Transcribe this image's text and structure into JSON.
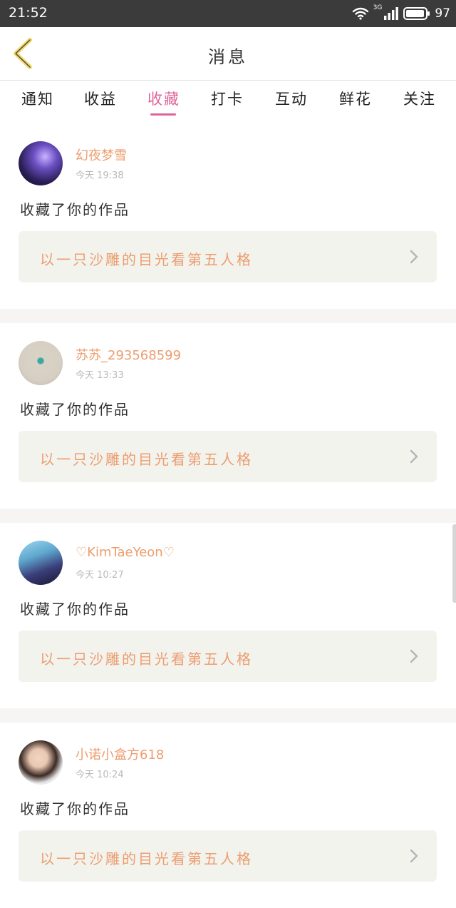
{
  "status_bar": {
    "time": "21:52",
    "network": "3G",
    "battery": "97",
    "battery_level": 0.97
  },
  "header": {
    "title": "消息"
  },
  "tabs": [
    {
      "label": "通知"
    },
    {
      "label": "收益"
    },
    {
      "label": "收藏"
    },
    {
      "label": "打卡"
    },
    {
      "label": "互动"
    },
    {
      "label": "鲜花"
    },
    {
      "label": "关注"
    }
  ],
  "active_tab": "收藏",
  "colors": {
    "accent_pink": "#e0649a",
    "accent_orange": "#ec9d6f",
    "card_bg": "#f3f3ee"
  },
  "notifications": [
    {
      "user": "幻夜梦雪",
      "time": "今天 19:38",
      "action": "收藏了你的作品",
      "work": "以一只沙雕的目光看第五人格"
    },
    {
      "user": "苏苏_293568599",
      "time": "今天 13:33",
      "action": "收藏了你的作品",
      "work": "以一只沙雕的目光看第五人格"
    },
    {
      "user": "♡KimTaeYeon♡",
      "time": "今天 10:27",
      "action": "收藏了你的作品",
      "work": "以一只沙雕的目光看第五人格"
    },
    {
      "user": "小诺小盒方618",
      "time": "今天 10:24",
      "action": "收藏了你的作品",
      "work": "以一只沙雕的目光看第五人格"
    }
  ]
}
